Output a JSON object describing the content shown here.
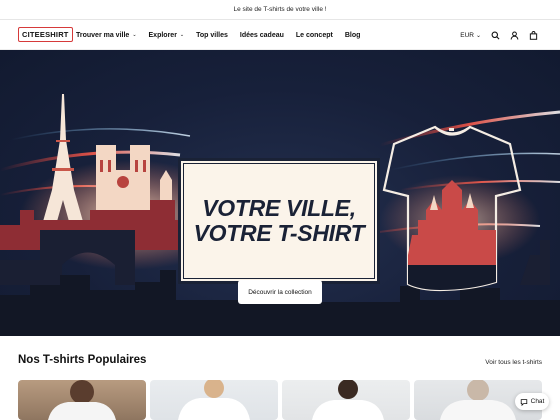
{
  "announcement": "Le site de T-shirts de votre ville !",
  "header": {
    "logo": "CITEESHIRT",
    "nav": [
      {
        "label": "Trouver ma ville",
        "dropdown": true
      },
      {
        "label": "Explorer",
        "dropdown": true
      },
      {
        "label": "Top villes",
        "dropdown": false
      },
      {
        "label": "Idées cadeau",
        "dropdown": false
      },
      {
        "label": "Le concept",
        "dropdown": false
      },
      {
        "label": "Blog",
        "dropdown": false
      }
    ],
    "currency": "EUR",
    "icons": [
      "search-icon",
      "account-icon",
      "cart-icon"
    ]
  },
  "hero": {
    "headline_line1": "VOTRE VILLE,",
    "headline_line2": "VOTRE T-SHIRT",
    "cta": "Découvrir la collection"
  },
  "section": {
    "title": "Nos T-shirts Populaires",
    "view_all": "Voir tous les t-shirts"
  },
  "chat_label": "Chat",
  "colors": {
    "hero_bg": "#17203a",
    "accent_red": "#d63a3a",
    "headline_box": "#fbf4ea"
  }
}
